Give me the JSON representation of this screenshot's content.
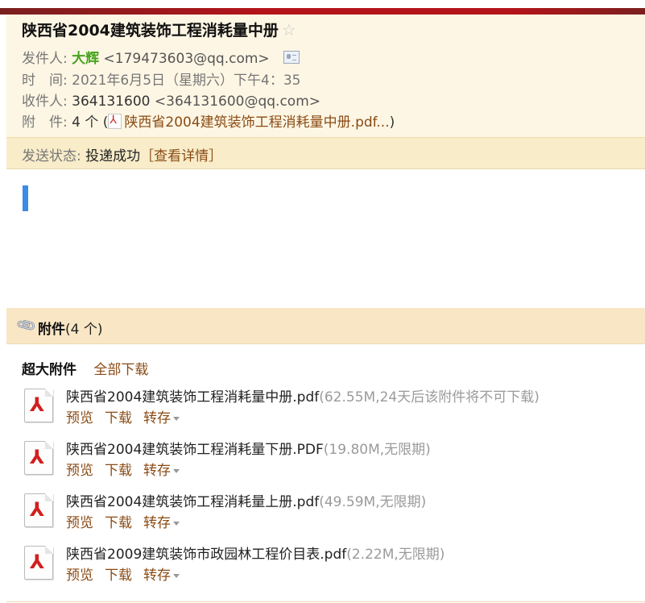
{
  "email": {
    "subject": "陕西省2004建筑装饰工程消耗量中册",
    "star_glyph": "☆",
    "from": {
      "label": "发件人:",
      "name": "大辉",
      "address": "<179473603@qq.com>"
    },
    "time": {
      "label": "时　间:",
      "value": "2021年6月5日（星期六）下午4：35"
    },
    "to": {
      "label": "收件人:",
      "name": "364131600",
      "address": "<364131600@qq.com>"
    },
    "attachments_line": {
      "label": "附　件:",
      "count": "4 个 (",
      "first": "陕西省2004建筑装饰工程消耗量中册.pdf...",
      "close": ")"
    },
    "status": {
      "label": "发送状态:",
      "value": "投递成功",
      "detail": "［查看详情］"
    }
  },
  "attachments": {
    "title": "附件",
    "count": "(4 个)",
    "big_label": "超大附件",
    "download_all": "全部下载",
    "items": [
      {
        "name": "陕西省2004建筑装饰工程消耗量中册.pdf",
        "meta": "(62.55M,24天后该附件将不可下载)"
      },
      {
        "name": "陕西省2004建筑装饰工程消耗量下册.PDF",
        "meta": "(19.80M,无限期)"
      },
      {
        "name": "陕西省2004建筑装饰工程消耗量上册.pdf",
        "meta": "(49.59M,无限期)"
      },
      {
        "name": "陕西省2009建筑装饰市政园林工程价目表.pdf",
        "meta": "(2.22M,无限期)"
      }
    ],
    "actions": {
      "preview": "预览",
      "download": "下载",
      "save": "转存"
    }
  },
  "icons": {
    "star": "star-icon",
    "vcard": "contact-card-icon",
    "pdf": "pdf-file-icon",
    "clip": "paperclip-icon",
    "caret": "caret-down-icon"
  },
  "colors": {
    "header_bg": "#fdf6e4",
    "status_bg": "#f8ecc9",
    "attach_head_bg": "#f9e6c4",
    "link": "#8a4b14",
    "sender_name": "#48a31f",
    "cursor": "#3b8be8",
    "top_bar": "#b3141a"
  }
}
